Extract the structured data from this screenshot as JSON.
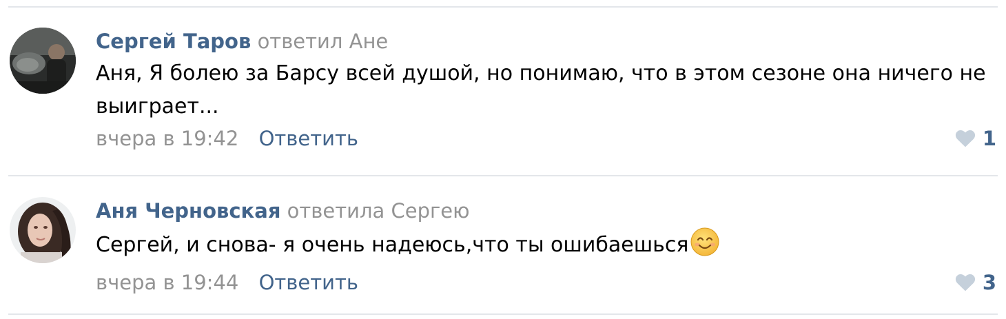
{
  "comments": [
    {
      "author": "Сергей Таров",
      "reply_to": "ответил Ане",
      "text": "Аня, Я болею за Барсу всей душой, но понимаю, что в этом сезоне она ничего не выиграет...",
      "date": "вчера в 19:42",
      "reply_label": "Ответить",
      "likes": "1",
      "like_icon": "heart-icon"
    },
    {
      "author": "Аня Черновская",
      "reply_to": "ответила Сергею",
      "text": "Сергей, и снова- я очень надеюсь,что ты ошибаешься",
      "emoji": "smiling-face-emoji",
      "date": "вчера в 19:44",
      "reply_label": "Ответить",
      "likes": "3",
      "like_icon": "heart-icon"
    }
  ],
  "colors": {
    "link": "#42648b",
    "muted": "#939393",
    "divider": "#e3e6ea",
    "heart": "#c5d0db"
  }
}
